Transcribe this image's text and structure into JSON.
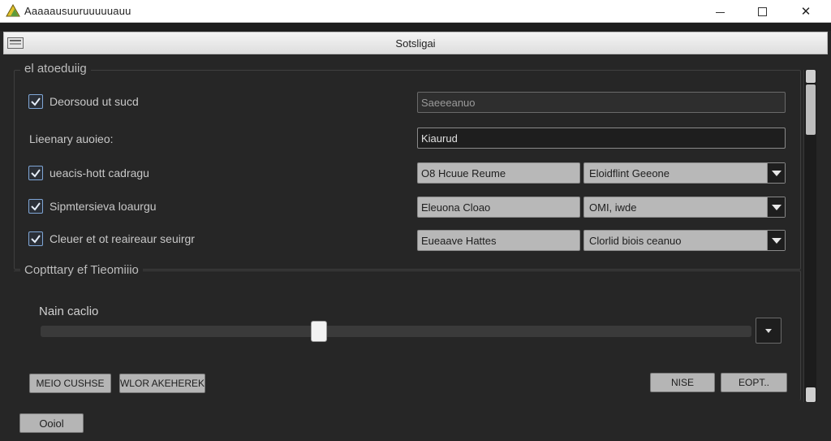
{
  "window": {
    "title": "Aaaaausuuruuuuuauu",
    "controls": {
      "minimize": "minimize",
      "maximize": "maximize",
      "close": "✕"
    }
  },
  "dialog": {
    "title": "Sotsligai"
  },
  "group1": {
    "title": "el atoeduiig",
    "rows": [
      {
        "label": "Deorsoud ut sucd",
        "checked": true,
        "field1": "Saeeeanuo"
      },
      {
        "label": "Lieenary auoieo:",
        "checked": false,
        "field1": "Kiaurud"
      },
      {
        "label": "ueacis-hott cadragu",
        "checked": true,
        "field1": "O8 Hcuue Reume",
        "combo": "Eloidflint Geeone"
      },
      {
        "label": "Sipmtersieva loaurgu",
        "checked": true,
        "field1": "Eleuona Cloao",
        "combo": "OMI, iwde"
      },
      {
        "label": "Cleuer et ot reaireaur seuirgr",
        "checked": true,
        "field1": "Eueaave Hattes",
        "combo": "Clorlid biois ceanuo"
      }
    ]
  },
  "group2": {
    "title": "Coptttary ef Tieomiiio",
    "slider_label": "Nain caclio",
    "slider_value": 0.392
  },
  "buttons": {
    "left1": "MEIO CUSHSE",
    "left2": "WLOR AKEHEREK",
    "right1": "NISE",
    "right2": "EOPT..",
    "bottom": "Ooiol"
  },
  "colors": {
    "accent": "#7fa6d6",
    "background": "#262626"
  },
  "icons": {
    "app": "app-logo-icon",
    "dialog": "dialog-window-icon",
    "check": "check-icon"
  }
}
